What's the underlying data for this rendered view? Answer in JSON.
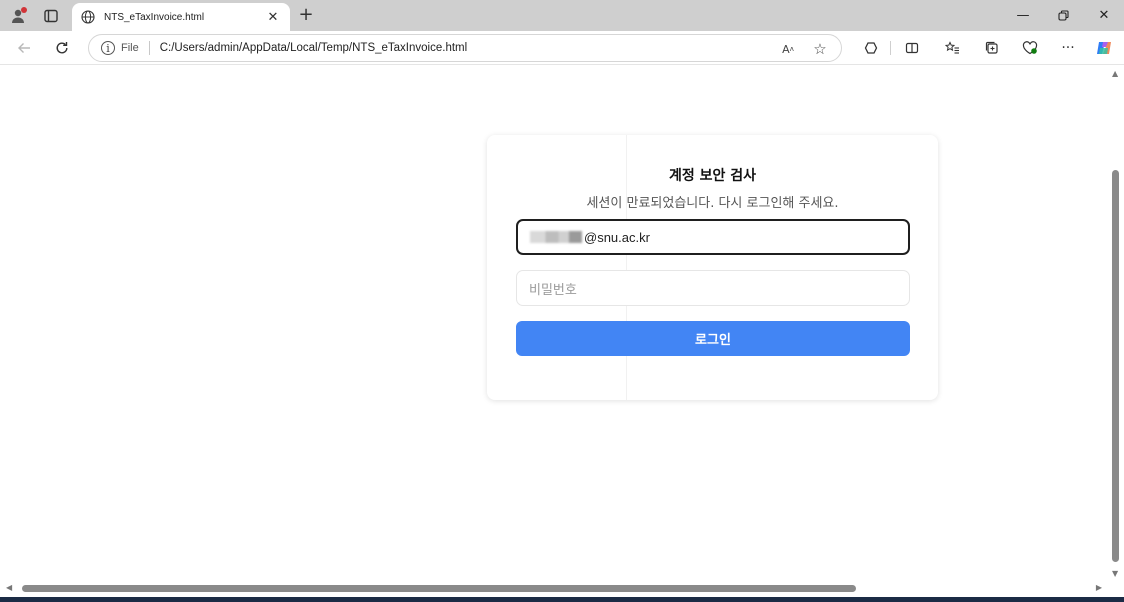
{
  "browser": {
    "tab_title": "NTS_eTaxInvoice.html",
    "address_scheme": "File",
    "address_url": "C:/Users/admin/AppData/Local/Temp/NTS_eTaxInvoice.html"
  },
  "icons": {
    "profile": "profile-icon",
    "tabs": "tab-actions-icon",
    "favicon": "globe-icon",
    "close_tab": "close-icon",
    "new_tab": "plus-icon",
    "minimize": "minimize-icon",
    "restore": "restore-icon",
    "close_window": "close-icon",
    "back": "back-arrow-icon",
    "reload": "reload-icon",
    "info": "info-icon",
    "read_aloud": "read-aloud-icon",
    "favorite": "star-icon",
    "extensions": [
      "extension-icon",
      "split-screen-icon",
      "favorites-icon",
      "collections-icon",
      "browser-essentials-icon",
      "more-icon",
      "copilot-icon"
    ]
  },
  "page": {
    "title": "계정 보안 검사",
    "subtitle": "세션이 만료되었습니다. 다시 로그인해 주세요.",
    "email_value": "@snu.ac.kr",
    "password_placeholder": "비밀번호",
    "login_label": "로그인"
  },
  "colors": {
    "primary_button": "#4285f4",
    "tab_strip": "#cfcfcf",
    "notification_dot": "#d13438"
  }
}
